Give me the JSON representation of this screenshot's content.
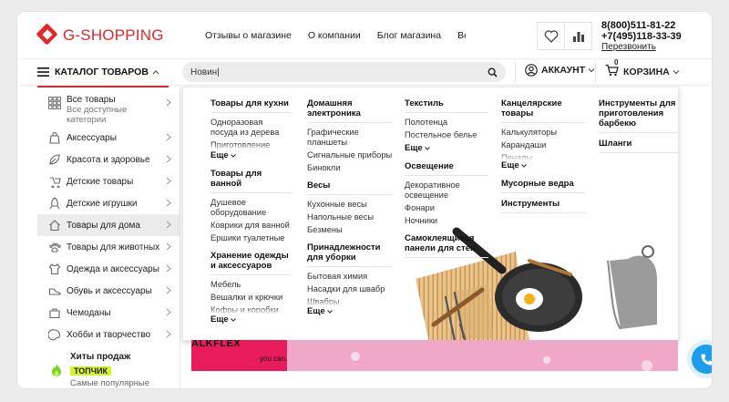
{
  "header": {
    "logo_text": "G-SHOPPING",
    "nav": [
      "Отзывы о магазине",
      "О компании",
      "Блог магазина",
      "Все бренды"
    ],
    "phone1": "8(800)511-81-22",
    "phone2": "+7(495)118-33-39",
    "callback": "Перезвонить"
  },
  "toolbar": {
    "catalog_label": "КАТАЛОГ ТОВАРОВ",
    "search_value": "Новин|",
    "account_label": "АККАУНТ",
    "cart_label": "КОРЗИНА",
    "cart_count": "0"
  },
  "sidebar": {
    "all_title": "Все товары",
    "all_sub": "Все доступные категории",
    "items": [
      {
        "label": "Аксессуары",
        "icon": "bag-icon"
      },
      {
        "label": "Красота и здоровье",
        "icon": "leaf-icon"
      },
      {
        "label": "Детские товары",
        "icon": "stroller-icon"
      },
      {
        "label": "Детские игрушки",
        "icon": "rocket-icon"
      },
      {
        "label": "Товары для дома",
        "icon": "house-icon"
      },
      {
        "label": "Товары для животных",
        "icon": "paw-icon"
      },
      {
        "label": "Одежда и аксессуары",
        "icon": "shirt-icon"
      },
      {
        "label": "Обувь и аксессуары",
        "icon": "shoe-icon"
      },
      {
        "label": "Чемоданы",
        "icon": "suitcase-icon"
      },
      {
        "label": "Хобби и творчество",
        "icon": "palette-icon"
      }
    ],
    "hits_title": "Хиты продаж",
    "hits_tag": "ТОПЧИК",
    "hits_sub": "Самые популярные"
  },
  "menu": {
    "col1": {
      "g1": "Товары для кухни",
      "g1_links": [
        "Одноразовая посуда из дерева",
        "Приготовление пищи"
      ],
      "g2": "Товары для ванной",
      "g2_links": [
        "Душевое оборудование",
        "Коврики для ванной",
        "Ершики туалетные"
      ],
      "g3": "Хранение одежды и аксессуаров",
      "g3_links": [
        "Мебель",
        "Вешалки и крючки",
        "Кофры и коробки"
      ]
    },
    "col2": {
      "g1": "Домашняя электроника",
      "g1_links": [
        "Графические планшеты",
        "Сигнальные приборы",
        "Бинокли"
      ],
      "g2": "Весы",
      "g2_links": [
        "Кухонные весы",
        "Напольные весы",
        "Безмены"
      ],
      "g3": "Принадлежности для уборки",
      "g3_links": [
        "Бытовая химия",
        "Насадки для швабр",
        "Швабры"
      ]
    },
    "col3": {
      "g1": "Текстиль",
      "g1_links": [
        "Полотенца",
        "Постельное белье"
      ],
      "g2": "Освещение",
      "g2_links": [
        "Декоративное освещение",
        "Фонари",
        "Ночники"
      ],
      "g3": "Самоклеящиеся панели для стен"
    },
    "col4": {
      "g1": "Канцелярские товары",
      "g1_links": [
        "Калькуляторы",
        "Карандаши",
        "Пеналы"
      ],
      "g2": "Мусорные ведра",
      "g3": "Инструменты"
    },
    "col5": {
      "g1": "Инструменты для приготовления барбекю",
      "g2": "Шланги"
    },
    "more": "Еще"
  },
  "banner": {
    "brand": "ALKFLEX",
    "tagline": "you can."
  },
  "colors": {
    "brand": "#e3262b",
    "chat": "#1e9dea",
    "highlight": "#d5f52b"
  }
}
